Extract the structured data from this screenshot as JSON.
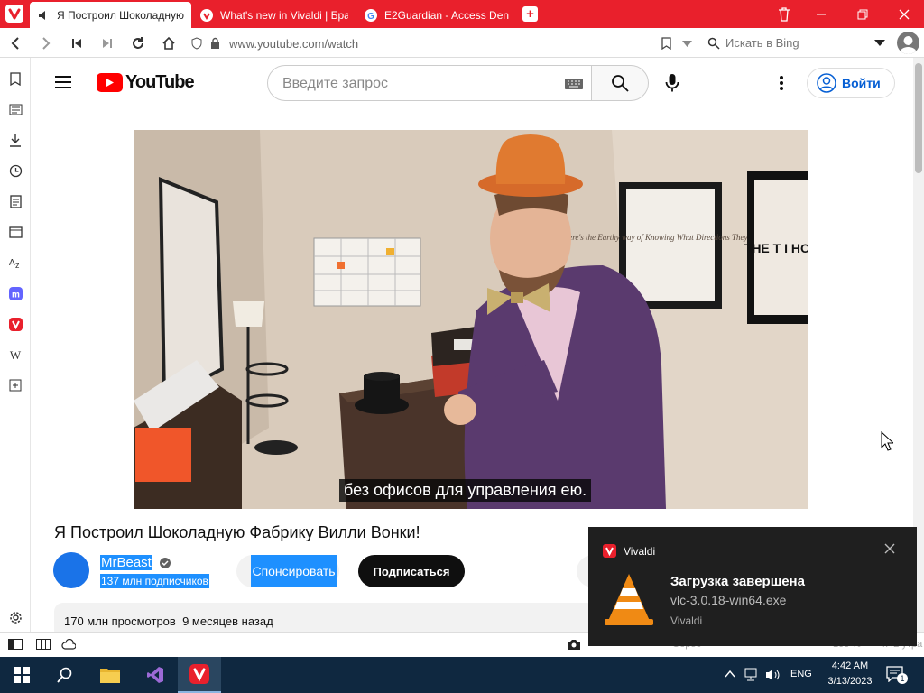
{
  "colors": {
    "accent": "#e9202c",
    "youtube_red": "#ff0000",
    "selection": "#1e90ff",
    "taskbar": "#0f2840"
  },
  "tabs": [
    {
      "label": "Я Построил Шоколадную",
      "icon": "speaker-icon",
      "active": true
    },
    {
      "label": "What's new in Vivaldi | Бра",
      "icon": "vivaldi-icon",
      "active": false
    },
    {
      "label": "E2Guardian - Access Denie",
      "icon": "google-icon",
      "active": false
    }
  ],
  "address": {
    "url": "www.youtube.com/watch",
    "search_placeholder": "Искать в Bing"
  },
  "youtube": {
    "logo_text": "YouTube",
    "search_placeholder": "Введите запрос",
    "signin_label": "Войти",
    "caption": "без офисов для управления ею.",
    "video_title": "Я Построил Шоколадную Фабрику Вилли Вонки!",
    "channel_name": "MrBeast",
    "channel_subs": "137 млн подписчиков",
    "sponsor_label": "Спонсировать",
    "subscribe_label": "Подписаться",
    "views": "170 млн просмотров",
    "date": "9 месяцев назад"
  },
  "video_scene": {
    "poster_text": "Here's the Earthy way of Knowing What Directions They're Going",
    "poster2_text": "THE T I HOP"
  },
  "status": {
    "zoom": "100 %",
    "clock_time": "4:42 утра",
    "reset_label": "Сброс"
  },
  "toast": {
    "app": "Vivaldi",
    "title": "Загрузка завершена",
    "file": "vlc-3.0.18-win64.exe",
    "source": "Vivaldi"
  },
  "taskbar": {
    "time": "4:42 AM",
    "date": "3/13/2023",
    "lang": "ENG",
    "notif_count": "1"
  }
}
